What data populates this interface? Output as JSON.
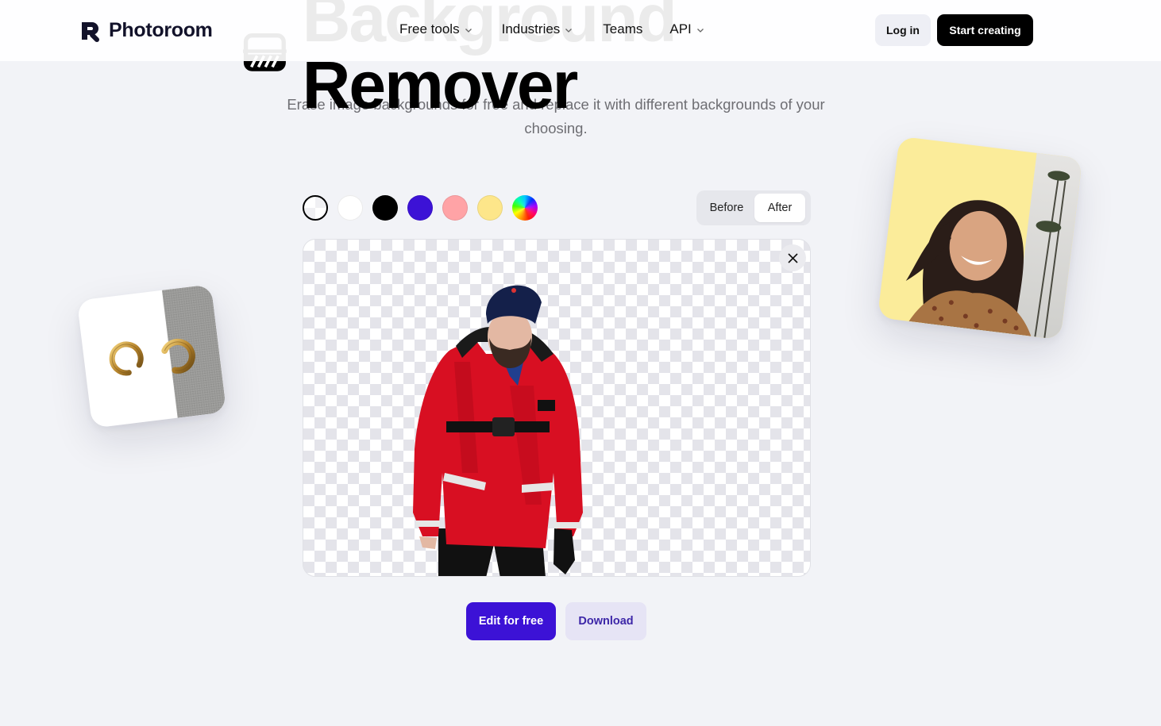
{
  "header": {
    "brand": "Photoroom",
    "nav": [
      {
        "label": "Free tools",
        "has_dropdown": true,
        "icon": "chevron-down-icon"
      },
      {
        "label": "Industries",
        "has_dropdown": true,
        "icon": "chevron-down-icon"
      },
      {
        "label": "Teams",
        "has_dropdown": false
      },
      {
        "label": "API",
        "has_dropdown": true,
        "icon": "chevron-down-icon"
      }
    ],
    "login_label": "Log in",
    "start_label": "Start creating"
  },
  "hero": {
    "title": "Background Remover",
    "icon": "background-remover-icon",
    "subtitle": "Erase image backgrounds for free and replace it with different backgrounds of your choosing."
  },
  "editor": {
    "swatches": [
      {
        "name": "transparent",
        "color": "transparent",
        "selected": true
      },
      {
        "name": "white",
        "color": "#ffffff"
      },
      {
        "name": "black",
        "color": "#000000"
      },
      {
        "name": "purple",
        "color": "#3c12d6"
      },
      {
        "name": "pink",
        "color": "#ffa3a6"
      },
      {
        "name": "yellow",
        "color": "#fde68a"
      },
      {
        "name": "custom-color",
        "color": "rainbow"
      }
    ],
    "toggle": {
      "before_label": "Before",
      "after_label": "After",
      "active": "After"
    },
    "image_alt": "Man in red jacket with background removed",
    "close_icon": "close-icon"
  },
  "actions": {
    "edit_label": "Edit for free",
    "download_label": "Download"
  },
  "colors": {
    "accent": "#3c12d6",
    "page_bg": "#f2f3f7",
    "download_bg": "#e6e4f5"
  }
}
